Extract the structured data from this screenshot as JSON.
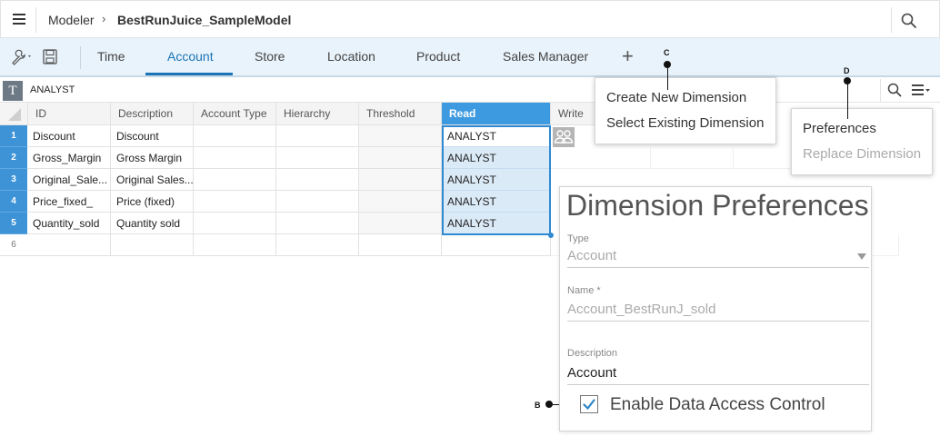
{
  "header": {
    "app": "Modeler",
    "breadcrumb_separator": "›",
    "model_name": "BestRunJuice_SampleModel"
  },
  "tabs": [
    {
      "label": "Time"
    },
    {
      "label": "Account",
      "active": true
    },
    {
      "label": "Store"
    },
    {
      "label": "Location"
    },
    {
      "label": "Product"
    },
    {
      "label": "Sales Manager"
    }
  ],
  "add_tab_label": "+",
  "formula_bar": {
    "type_badge": "T",
    "value": "ANALYST"
  },
  "grid": {
    "columns": [
      "ID",
      "Description",
      "Account Type",
      "Hierarchy",
      "Threshold",
      "Read",
      "Write"
    ],
    "rows": [
      {
        "num": "1",
        "id": "Discount",
        "description": "Discount",
        "read": "ANALYST"
      },
      {
        "num": "2",
        "id": "Gross_Margin",
        "description": "Gross Margin",
        "read": "ANALYST"
      },
      {
        "num": "3",
        "id": "Original_Sale...",
        "description": "Original Sales...",
        "read": "ANALYST"
      },
      {
        "num": "4",
        "id": "Price_fixed_",
        "description": "Price (fixed)",
        "read": "ANALYST"
      },
      {
        "num": "5",
        "id": "Quantity_sold",
        "description": "Quantity sold",
        "read": "ANALYST"
      },
      {
        "num": "6",
        "id": "",
        "description": "",
        "read": ""
      }
    ]
  },
  "add_menu": {
    "items": [
      "Create New Dimension",
      "Select Existing Dimension"
    ]
  },
  "settings_menu": {
    "items": [
      "Preferences",
      "Replace Dimension"
    ]
  },
  "callouts": {
    "b": "B",
    "c": "C",
    "d": "D"
  },
  "prefs_panel": {
    "title": "Dimension Preferences",
    "type_label": "Type",
    "type_value": "Account",
    "name_label": "Name *",
    "name_value": "Account_BestRunJ_sold",
    "description_label": "Description",
    "description_value": "Account",
    "checkbox_label": "Enable Data Access Control",
    "checkbox_checked": true
  },
  "colors": {
    "accent": "#1a74b7",
    "row_number": "#3e93d6",
    "read_header": "#3e9ae0",
    "read_cells": "#dbeaf7",
    "tabbar": "#e9f3fb"
  }
}
